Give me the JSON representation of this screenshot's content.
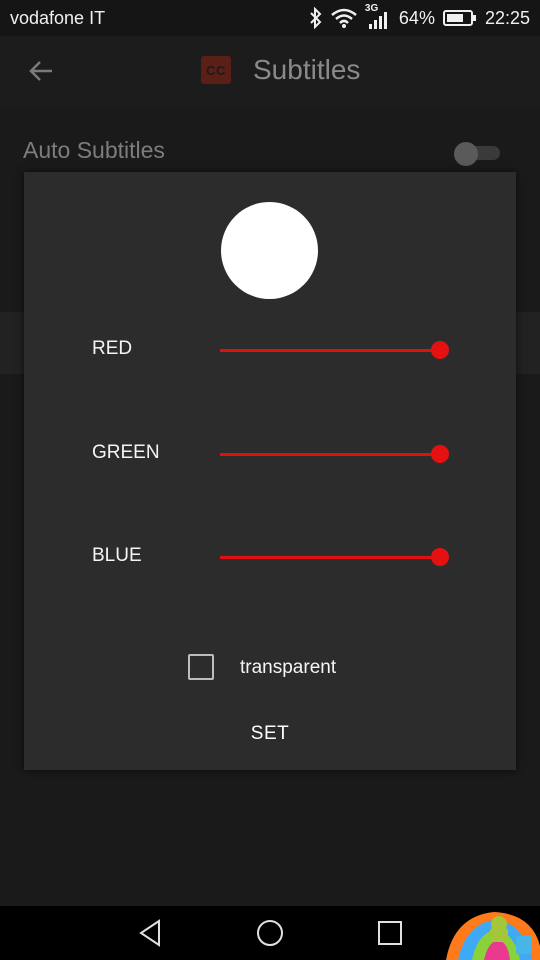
{
  "status_bar": {
    "carrier": "vodafone IT",
    "network": "3G",
    "battery": "64%",
    "time": "22:25",
    "icons": [
      "bluetooth-icon",
      "wifi-icon",
      "signal-icon",
      "battery-icon"
    ]
  },
  "app_bar": {
    "title": "Subtitles",
    "badge_text": "CC",
    "accent_color": "#5a1f16"
  },
  "settings": {
    "auto_subtitles_label": "Auto Subtitles",
    "auto_subtitles_on": false
  },
  "color_dialog": {
    "preview_color": "#ffffff",
    "sliders": [
      {
        "label": "RED",
        "value": 1.0
      },
      {
        "label": "GREEN",
        "value": 1.0
      },
      {
        "label": "BLUE",
        "value": 1.0
      }
    ],
    "slider_color": "#e01010",
    "transparent_label": "transparent",
    "transparent_checked": false,
    "set_label": "SET"
  },
  "nav_bar": {
    "buttons": [
      "back-icon",
      "home-icon",
      "recents-icon"
    ]
  }
}
